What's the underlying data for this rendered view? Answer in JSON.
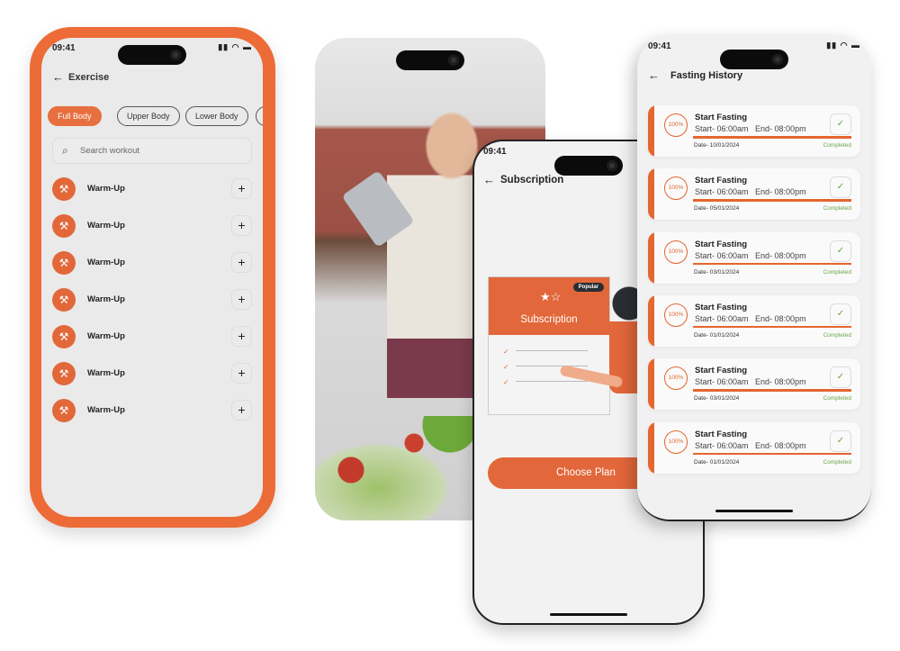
{
  "brand_color": "#E86F3F",
  "status_time": "09:41",
  "exercise": {
    "title": "Exercise",
    "chips": [
      {
        "label": "Full Body",
        "active": true
      },
      {
        "label": "Upper Body",
        "active": false
      },
      {
        "label": "Lower Body",
        "active": false
      }
    ],
    "search_placeholder": "Search workout",
    "items": [
      "Warm-Up",
      "Warm-Up",
      "Warm-Up",
      "Warm-Up",
      "Warm-Up",
      "Warm-Up",
      "Warm-Up"
    ]
  },
  "subscription": {
    "title": "Subscription",
    "card_title": "Subscription",
    "badge": "Popular",
    "cta": "Choose Plan"
  },
  "fasting": {
    "title": "Fasting History",
    "items": [
      {
        "pct": "100%",
        "title": "Start Fasting",
        "times": "Start- 06:00am   End- 08:00pm",
        "date": "Date- 10/01/2024",
        "status": "Completed"
      },
      {
        "pct": "100%",
        "title": "Start Fasting",
        "times": "Start- 06:00am   End- 08:00pm",
        "date": "Date- 05/01/2024",
        "status": "Completed"
      },
      {
        "pct": "100%",
        "title": "Start Fasting",
        "times": "Start- 06:00am   End- 08:00pm",
        "date": "Date- 03/01/2024",
        "status": "Completed"
      },
      {
        "pct": "100%",
        "title": "Start Fasting",
        "times": "Start- 06:00am   End- 08:00pm",
        "date": "Date- 01/01/2024",
        "status": "Completed"
      },
      {
        "pct": "100%",
        "title": "Start Fasting",
        "times": "Start- 06:00am   End- 08:00pm",
        "date": "Date- 03/01/2024",
        "status": "Completed"
      },
      {
        "pct": "100%",
        "title": "Start Fasting",
        "times": "Start- 06:00am   End- 08:00pm",
        "date": "Date- 01/01/2024",
        "status": "Completed"
      }
    ]
  }
}
